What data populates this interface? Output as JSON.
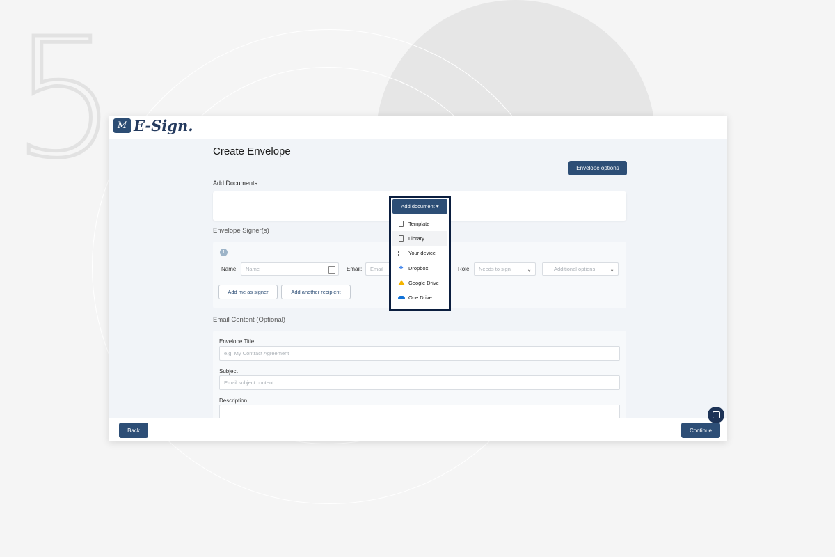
{
  "step_number": "5",
  "app": {
    "logo_mark": "M",
    "logo_text": "E-Sign."
  },
  "page": {
    "title": "Create Envelope"
  },
  "toolbar": {
    "envelope_options_label": "Envelope options"
  },
  "documents": {
    "section_label": "Add Documents",
    "add_button_label": "Add document ▾",
    "menu_items": [
      {
        "label": "Template",
        "icon": "template-icon"
      },
      {
        "label": "Library",
        "icon": "library-icon"
      },
      {
        "label": "Your device",
        "icon": "device-icon"
      },
      {
        "label": "Dropbox",
        "icon": "dropbox-icon"
      },
      {
        "label": "Google Drive",
        "icon": "google-drive-icon"
      },
      {
        "label": "One Drive",
        "icon": "onedrive-icon"
      }
    ]
  },
  "signers": {
    "section_label": "Envelope Signer(s)",
    "step_badge": "1",
    "name_label": "Name:",
    "name_placeholder": "Name",
    "email_label": "Email:",
    "email_placeholder": "Email",
    "role_label": "Role:",
    "role_value": "Needs to sign",
    "additional_options": "Additional options",
    "add_me_label": "Add me as signer",
    "add_another_label": "Add another recipient"
  },
  "email": {
    "section_label": "Email Content (Optional)",
    "title_label": "Envelope Title",
    "title_placeholder": "e.g. My Contract Agreement",
    "subject_label": "Subject",
    "subject_placeholder": "Email subject content",
    "description_label": "Description"
  },
  "footer": {
    "back_label": "Back",
    "continue_label": "Continue"
  },
  "colors": {
    "primary": "#2d4e76",
    "highlight_border": "#0b1e3f",
    "background": "#f5f5f5"
  }
}
